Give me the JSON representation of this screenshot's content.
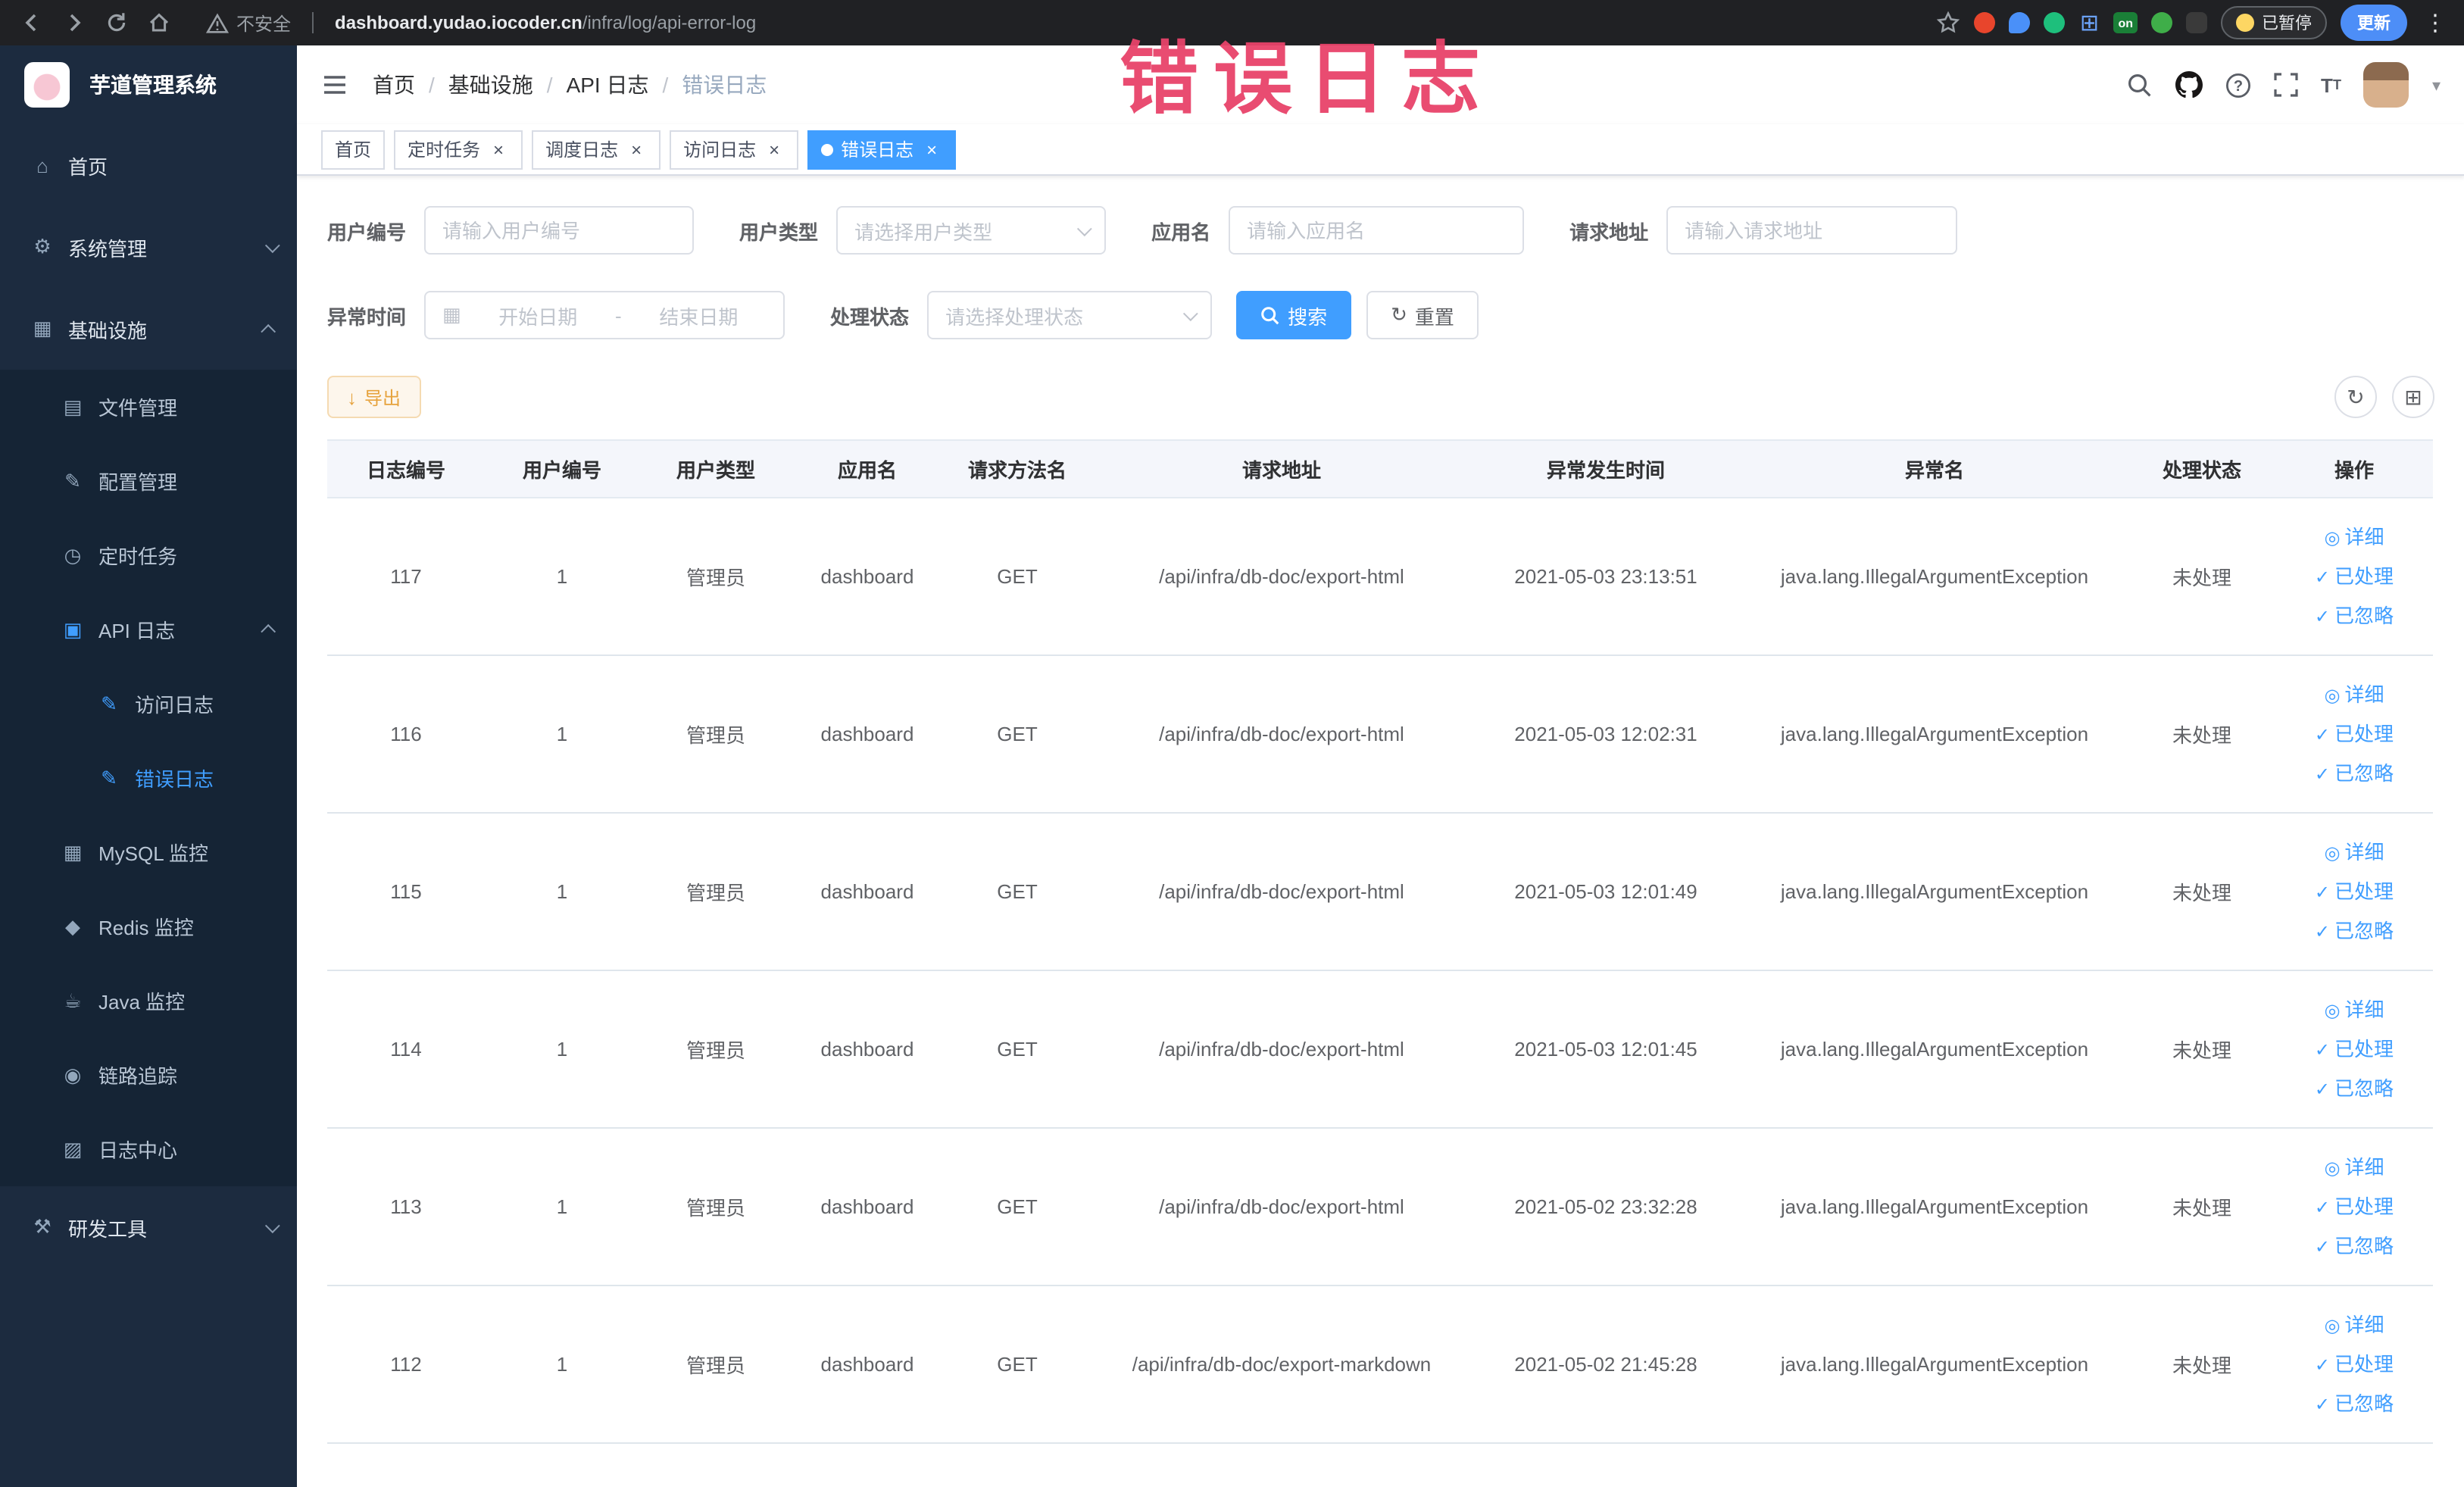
{
  "colors": {
    "primary": "#409eff",
    "annotation_red": "#e8436a",
    "sidebar_bg": "#1c2b3f",
    "warning_orange": "#e6a23c"
  },
  "browser": {
    "security_label": "不安全",
    "url_domain": "dashboard.yudao.iocoder.cn",
    "url_path": "/infra/log/api-error-log",
    "extension_on_badge": "on",
    "paused_badge": "已暂停",
    "update_button": "更新"
  },
  "sidebar": {
    "logo_title": "芋道管理系统",
    "items": [
      {
        "key": "home",
        "label": "首页",
        "depth": 1,
        "icon": "home"
      },
      {
        "key": "system",
        "label": "系统管理",
        "depth": 1,
        "icon": "gear",
        "arrow": "down"
      },
      {
        "key": "infra",
        "label": "基础设施",
        "depth": 1,
        "icon": "monitor",
        "arrow": "up"
      },
      {
        "key": "file",
        "label": "文件管理",
        "depth": 2,
        "icon": "folder"
      },
      {
        "key": "config",
        "label": "配置管理",
        "depth": 2,
        "icon": "edit"
      },
      {
        "key": "job",
        "label": "定时任务",
        "depth": 2,
        "icon": "timer"
      },
      {
        "key": "api-log",
        "label": "API 日志",
        "depth": 2,
        "icon": "document",
        "arrow": "up"
      },
      {
        "key": "access-log",
        "label": "访问日志",
        "depth": 3,
        "icon": "doc-edit"
      },
      {
        "key": "error-log",
        "label": "错误日志",
        "depth": 3,
        "icon": "doc-edit",
        "active": true
      },
      {
        "key": "mysql",
        "label": "MySQL 监控",
        "depth": 2,
        "icon": "database"
      },
      {
        "key": "redis",
        "label": "Redis 监控",
        "depth": 2,
        "icon": "redis"
      },
      {
        "key": "java",
        "label": "Java 监控",
        "depth": 2,
        "icon": "coffee"
      },
      {
        "key": "trace",
        "label": "链路追踪",
        "depth": 2,
        "icon": "link"
      },
      {
        "key": "log-center",
        "label": "日志中心",
        "depth": 2,
        "icon": "log"
      },
      {
        "key": "devtools",
        "label": "研发工具",
        "depth": 1,
        "icon": "tools",
        "arrow": "down"
      }
    ]
  },
  "header": {
    "breadcrumbs": [
      "首页",
      "基础设施",
      "API 日志",
      "错误日志"
    ]
  },
  "tabs": [
    {
      "key": "home",
      "label": "首页",
      "closable": false,
      "active": false
    },
    {
      "key": "job",
      "label": "定时任务",
      "closable": true,
      "active": false
    },
    {
      "key": "job-log",
      "label": "调度日志",
      "closable": true,
      "active": false
    },
    {
      "key": "access-log",
      "label": "访问日志",
      "closable": true,
      "active": false
    },
    {
      "key": "error-log",
      "label": "错误日志",
      "closable": true,
      "active": true
    }
  ],
  "annotation": {
    "text": "错误日志",
    "color": "#e8436a"
  },
  "filters": {
    "user_id": {
      "label": "用户编号",
      "placeholder": "请输入用户编号"
    },
    "user_type": {
      "label": "用户类型",
      "placeholder": "请选择用户类型"
    },
    "app_name": {
      "label": "应用名",
      "placeholder": "请输入应用名"
    },
    "request_url": {
      "label": "请求地址",
      "placeholder": "请输入请求地址"
    },
    "exception_time": {
      "label": "异常时间",
      "start_placeholder": "开始日期",
      "separator": "-",
      "end_placeholder": "结束日期"
    },
    "process_status": {
      "label": "处理状态",
      "placeholder": "请选择处理状态"
    },
    "search_button": "搜索",
    "reset_button": "重置"
  },
  "toolbar": {
    "export_button": "导出"
  },
  "table": {
    "columns": [
      "日志编号",
      "用户编号",
      "用户类型",
      "应用名",
      "请求方法名",
      "请求地址",
      "异常发生时间",
      "异常名",
      "处理状态",
      "操作"
    ],
    "col_keys": [
      "log-id",
      "user-id",
      "user-type",
      "app-name",
      "method",
      "url",
      "time",
      "exception",
      "status"
    ],
    "row_actions": [
      {
        "key": "detail",
        "label": "详细",
        "icon": "eye"
      },
      {
        "key": "processed",
        "label": "已处理",
        "icon": "check"
      },
      {
        "key": "ignored",
        "label": "已忽略",
        "icon": "check"
      }
    ],
    "rows": [
      {
        "log_id": "117",
        "user_id": "1",
        "user_type": "管理员",
        "app_name": "dashboard",
        "method": "GET",
        "url": "/api/infra/db-doc/export-html",
        "time": "2021-05-03 23:13:51",
        "exception": "java.lang.IllegalArgumentException",
        "status": "未处理"
      },
      {
        "log_id": "116",
        "user_id": "1",
        "user_type": "管理员",
        "app_name": "dashboard",
        "method": "GET",
        "url": "/api/infra/db-doc/export-html",
        "time": "2021-05-03 12:02:31",
        "exception": "java.lang.IllegalArgumentException",
        "status": "未处理"
      },
      {
        "log_id": "115",
        "user_id": "1",
        "user_type": "管理员",
        "app_name": "dashboard",
        "method": "GET",
        "url": "/api/infra/db-doc/export-html",
        "time": "2021-05-03 12:01:49",
        "exception": "java.lang.IllegalArgumentException",
        "status": "未处理"
      },
      {
        "log_id": "114",
        "user_id": "1",
        "user_type": "管理员",
        "app_name": "dashboard",
        "method": "GET",
        "url": "/api/infra/db-doc/export-html",
        "time": "2021-05-03 12:01:45",
        "exception": "java.lang.IllegalArgumentException",
        "status": "未处理"
      },
      {
        "log_id": "113",
        "user_id": "1",
        "user_type": "管理员",
        "app_name": "dashboard",
        "method": "GET",
        "url": "/api/infra/db-doc/export-html",
        "time": "2021-05-02 23:32:28",
        "exception": "java.lang.IllegalArgumentException",
        "status": "未处理"
      },
      {
        "log_id": "112",
        "user_id": "1",
        "user_type": "管理员",
        "app_name": "dashboard",
        "method": "GET",
        "url": "/api/infra/db-doc/export-markdown",
        "time": "2021-05-02 21:45:28",
        "exception": "java.lang.IllegalArgumentException",
        "status": "未处理"
      }
    ]
  }
}
